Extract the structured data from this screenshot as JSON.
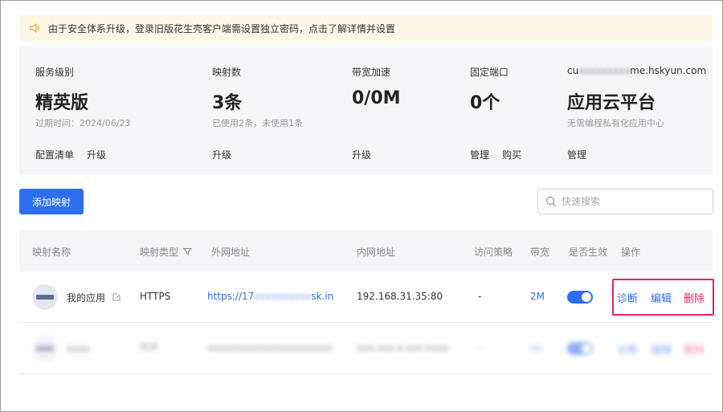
{
  "notice": {
    "text": "由于安全体系升级，登录旧版花生壳客户端需设置独立密码，点击了解详情并设置"
  },
  "stats": [
    {
      "label": "服务级别",
      "value": "精英版",
      "sub": "过期时间：2024/06/23",
      "actions": [
        "配置清单",
        "升级"
      ]
    },
    {
      "label": "映射数",
      "value": "3条",
      "sub": "已使用2条，未使用1条",
      "actions": [
        "升级"
      ]
    },
    {
      "label": "带宽加速",
      "value": "0/0M",
      "sub": "",
      "actions": [
        "升级"
      ]
    },
    {
      "label": "固定端口",
      "value": "0个",
      "sub": "",
      "actions": [
        "管理",
        "购买"
      ]
    },
    {
      "label_prefix": "cu",
      "label_hidden": "xxxxxxxxx",
      "label_suffix": "me.hskyun.com",
      "value": "应用云平台",
      "sub": "无需编程私有化应用中心",
      "actions": [
        "管理"
      ]
    }
  ],
  "toolbar": {
    "add_label": "添加映射",
    "search_placeholder": "快速搜索"
  },
  "table": {
    "headers": [
      "映射名称",
      "映射类型",
      "外网地址",
      "内网地址",
      "访问策略",
      "带宽",
      "是否生效",
      "操作"
    ],
    "rows": [
      {
        "name": "我的应用",
        "type": "HTTPS",
        "external_prefix": "https://17",
        "external_hidden": "xxxxxxxxxx",
        "external_suffix": "sk.in",
        "internal": "192.168.31.35:80",
        "policy": "-",
        "bandwidth": "2M",
        "enabled": true,
        "ops": [
          "诊断",
          "编辑",
          "删除"
        ]
      },
      {
        "name": "xxxx",
        "type": "TCP",
        "external": "xxxxxxxxxxxxxxxxxxxxxx",
        "internal": "xxx.xxx.x.xxx:xxxx",
        "policy": "-",
        "bandwidth": "xx",
        "enabled": true,
        "ops": [
          "诊断",
          "编辑",
          "删除"
        ]
      }
    ]
  },
  "colors": {
    "accent": "#2d6ef0",
    "danger": "#e0265a",
    "notice_bg": "#fdf8e6",
    "panel_bg": "#f5f6f8"
  }
}
